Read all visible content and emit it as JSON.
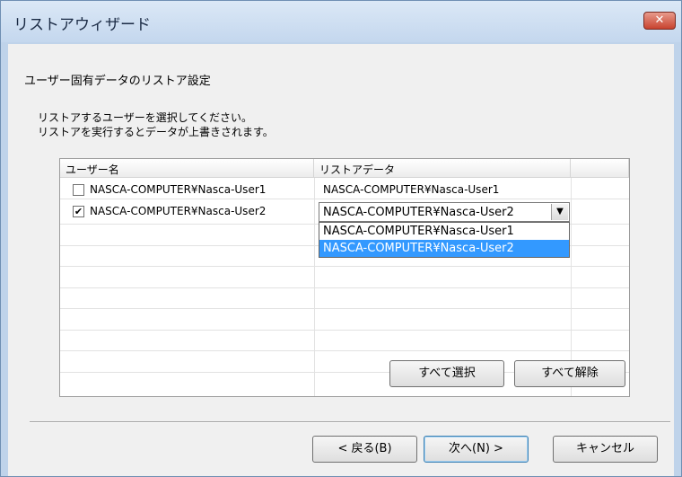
{
  "window": {
    "title": "リストアウィザード",
    "close_label": "✕"
  },
  "dialog": {
    "heading": "ユーザー固有データのリストア設定",
    "instruction_line1": "リストアするユーザーを選択してください。",
    "instruction_line2": "リストアを実行するとデータが上書きされます。"
  },
  "grid": {
    "columns": [
      "ユーザー名",
      "リストアデータ"
    ],
    "rows": [
      {
        "checked": false,
        "user": "NASCA-COMPUTER¥Nasca-User1",
        "data": "NASCA-COMPUTER¥Nasca-User1"
      },
      {
        "checked": true,
        "user": "NASCA-COMPUTER¥Nasca-User2",
        "data": "NASCA-COMPUTER¥Nasca-User2"
      }
    ],
    "dropdown": {
      "selected_display": "NASCA-COMPUTER¥Nasca-User2",
      "arrow": "▼",
      "options": [
        "NASCA-COMPUTER¥Nasca-User1",
        "NASCA-COMPUTER¥Nasca-User2"
      ],
      "highlighted_index": 1
    }
  },
  "buttons": {
    "select_all": "すべて選択",
    "clear_all": "すべて解除",
    "back": "< 戻る(B)",
    "next": "次へ(N) >",
    "cancel": "キャンセル"
  },
  "colors": {
    "selection": "#3399ff",
    "close_button": "#c8432f",
    "title_bar": "#c4d7ee"
  }
}
